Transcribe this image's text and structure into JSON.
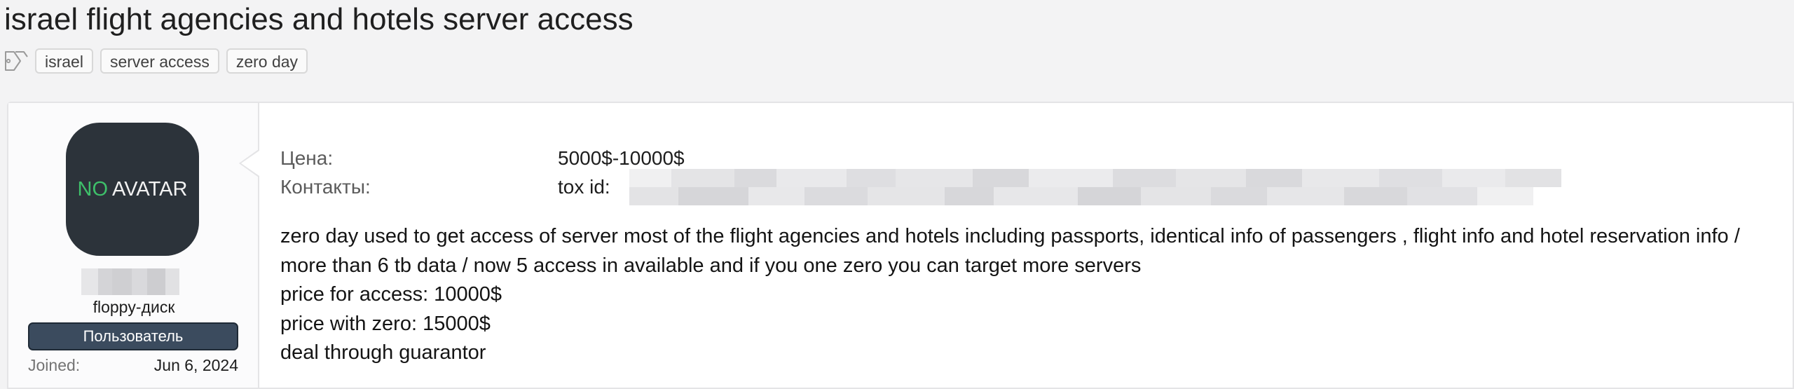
{
  "thread": {
    "title": "israel flight agencies and hotels server access",
    "tags": [
      "israel",
      "server access",
      "zero day"
    ]
  },
  "author": {
    "avatar_text_prefix": "NO",
    "avatar_text_suffix": "AVATAR",
    "user_title": "floppy-диск",
    "role": "Пользователь",
    "joined_label": "Joined:",
    "joined_value": "Jun 6, 2024"
  },
  "post": {
    "price_label": "Цена:",
    "price_value": "5000$-10000$",
    "contacts_label": "Контакты:",
    "contacts_value": "tox id:",
    "body_lines": [
      "zero day used to get access of server most of the flight agencies and hotels including passports, identical info of passengers , flight info and hotel reservation info / more than 6 tb data / now 5 access in available and if you one zero you can target more servers",
      "price for access: 10000$",
      "price with zero: 15000$",
      "deal through guarantor"
    ]
  },
  "colors": {
    "page_background": "#f3f3f4",
    "avatar_background": "#2c333a",
    "avatar_accent": "#3ec06a",
    "role_badge": "#3b4b5e"
  },
  "icons": {
    "tags": "tags-icon"
  }
}
